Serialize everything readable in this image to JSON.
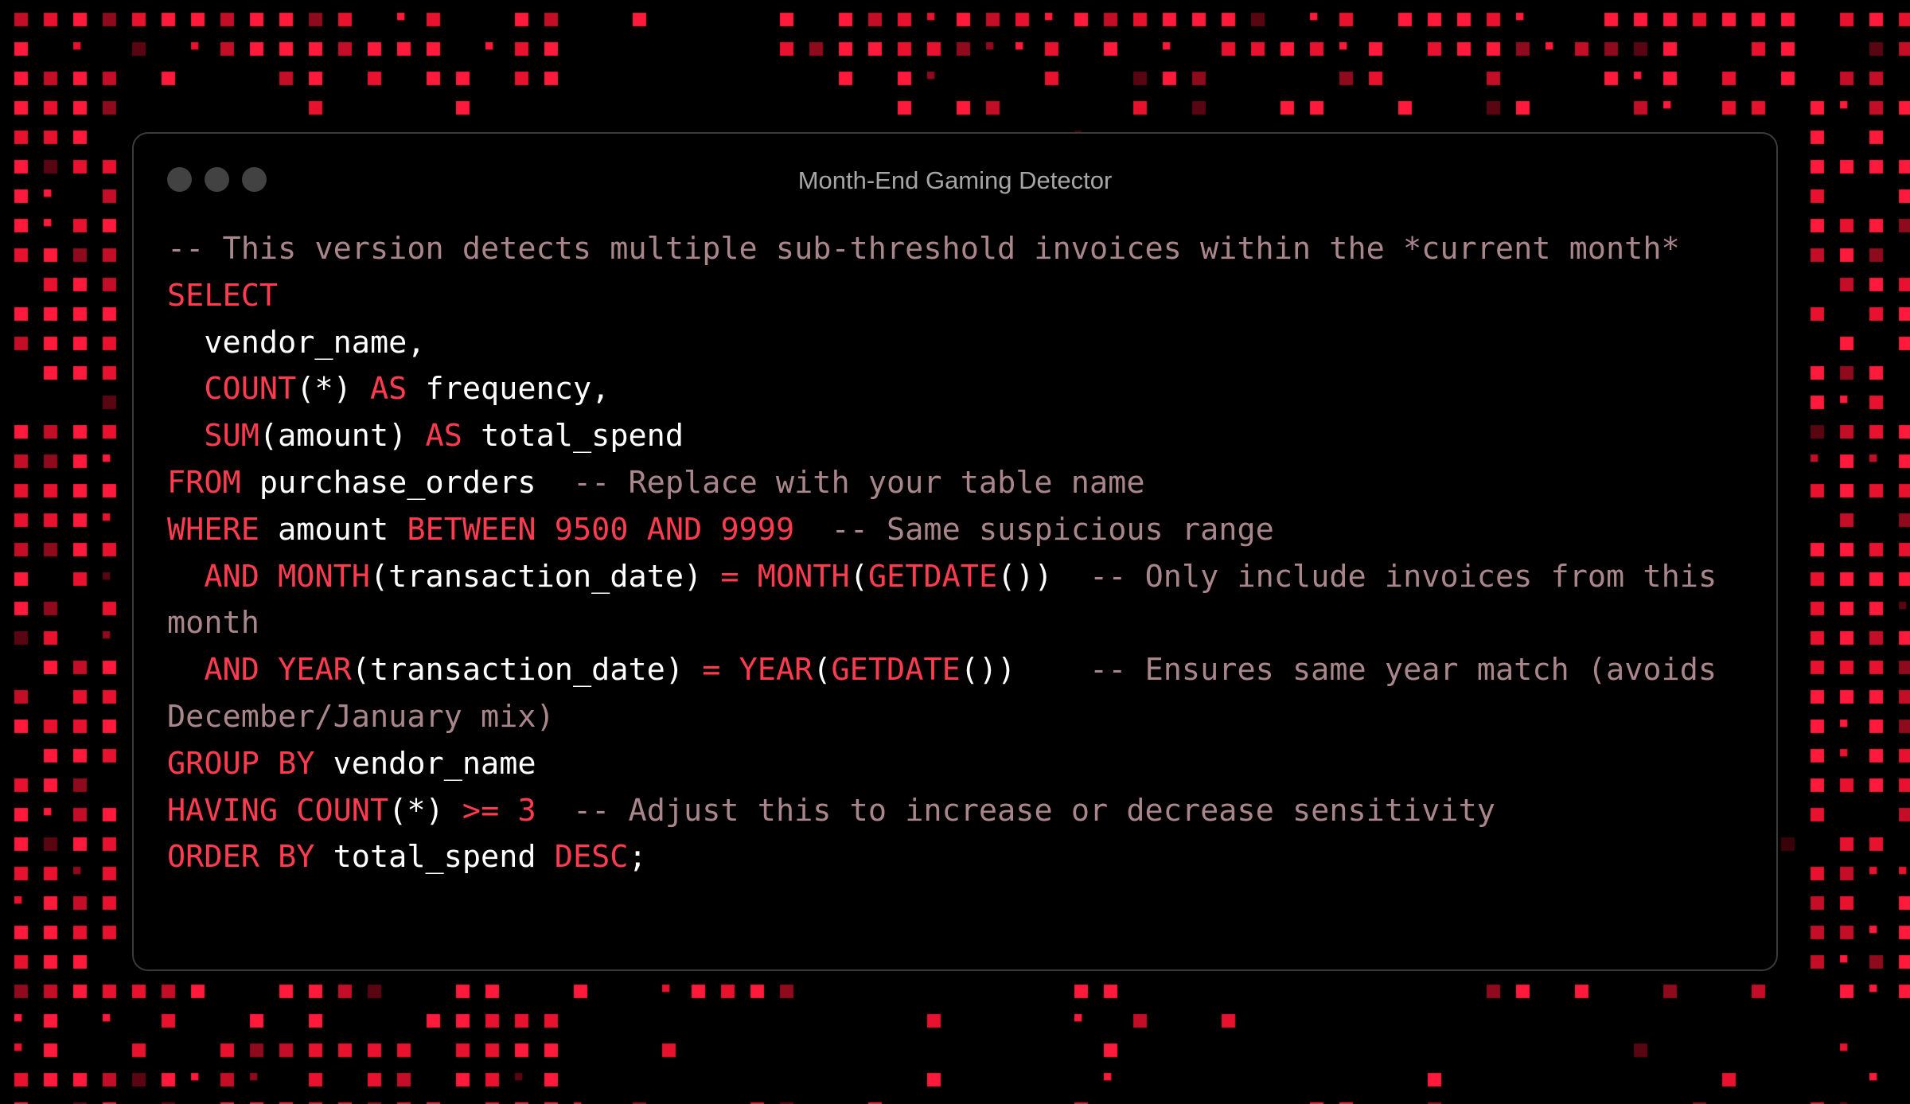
{
  "window": {
    "title": "Month-End Gaming Detector",
    "controls": [
      "close-dot",
      "minimize-dot",
      "maximize-dot"
    ]
  },
  "colors": {
    "background": "#000000",
    "accent": "#ff3b50",
    "keyword": "#ff3b50",
    "plain": "#ffffff",
    "comment": "#a9868b",
    "window_border": "#3b3b3b",
    "title": "#a6a6a6"
  },
  "code": {
    "language": "SQL",
    "lines": [
      [
        [
          "cm",
          "-- This version detects multiple sub-threshold invoices within the *current month*"
        ]
      ],
      [
        [
          "kw",
          "SELECT"
        ]
      ],
      [
        [
          "pl",
          "  vendor_name,"
        ]
      ],
      [
        [
          "pl",
          "  "
        ],
        [
          "kw",
          "COUNT"
        ],
        [
          "pl",
          "(*) "
        ],
        [
          "kw",
          "AS"
        ],
        [
          "pl",
          " frequency,"
        ]
      ],
      [
        [
          "pl",
          "  "
        ],
        [
          "kw",
          "SUM"
        ],
        [
          "pl",
          "(amount) "
        ],
        [
          "kw",
          "AS"
        ],
        [
          "pl",
          " total_spend"
        ]
      ],
      [
        [
          "kw",
          "FROM"
        ],
        [
          "pl",
          " purchase_orders  "
        ],
        [
          "cm",
          "-- Replace with your table name"
        ]
      ],
      [
        [
          "kw",
          "WHERE"
        ],
        [
          "pl",
          " amount "
        ],
        [
          "kw",
          "BETWEEN"
        ],
        [
          "pl",
          " "
        ],
        [
          "num",
          "9500"
        ],
        [
          "pl",
          " "
        ],
        [
          "kw",
          "AND"
        ],
        [
          "pl",
          " "
        ],
        [
          "num",
          "9999"
        ],
        [
          "pl",
          "  "
        ],
        [
          "cm",
          "-- Same suspicious range"
        ]
      ],
      [
        [
          "pl",
          "  "
        ],
        [
          "kw",
          "AND"
        ],
        [
          "pl",
          " "
        ],
        [
          "kw",
          "MONTH"
        ],
        [
          "pl",
          "(transaction_date) "
        ],
        [
          "kw",
          "="
        ],
        [
          "pl",
          " "
        ],
        [
          "kw",
          "MONTH"
        ],
        [
          "pl",
          "("
        ],
        [
          "kw",
          "GETDATE"
        ],
        [
          "pl",
          "())  "
        ],
        [
          "cm",
          "-- Only include invoices from this month"
        ]
      ],
      [
        [
          "pl",
          "  "
        ],
        [
          "kw",
          "AND"
        ],
        [
          "pl",
          " "
        ],
        [
          "kw",
          "YEAR"
        ],
        [
          "pl",
          "(transaction_date) "
        ],
        [
          "kw",
          "="
        ],
        [
          "pl",
          " "
        ],
        [
          "kw",
          "YEAR"
        ],
        [
          "pl",
          "("
        ],
        [
          "kw",
          "GETDATE"
        ],
        [
          "pl",
          "())    "
        ],
        [
          "cm",
          "-- Ensures same year match (avoids December/January mix)"
        ]
      ],
      [
        [
          "kw",
          "GROUP BY"
        ],
        [
          "pl",
          " vendor_name"
        ]
      ],
      [
        [
          "kw",
          "HAVING"
        ],
        [
          "pl",
          " "
        ],
        [
          "kw",
          "COUNT"
        ],
        [
          "pl",
          "(*) "
        ],
        [
          "kw",
          ">="
        ],
        [
          "pl",
          " "
        ],
        [
          "num",
          "3"
        ],
        [
          "pl",
          "  "
        ],
        [
          "cm",
          "-- Adjust this to increase or decrease sensitivity"
        ]
      ],
      [
        [
          "kw",
          "ORDER BY"
        ],
        [
          "pl",
          " total_spend "
        ],
        [
          "kw",
          "DESC"
        ],
        [
          "pl",
          ";"
        ]
      ]
    ]
  }
}
